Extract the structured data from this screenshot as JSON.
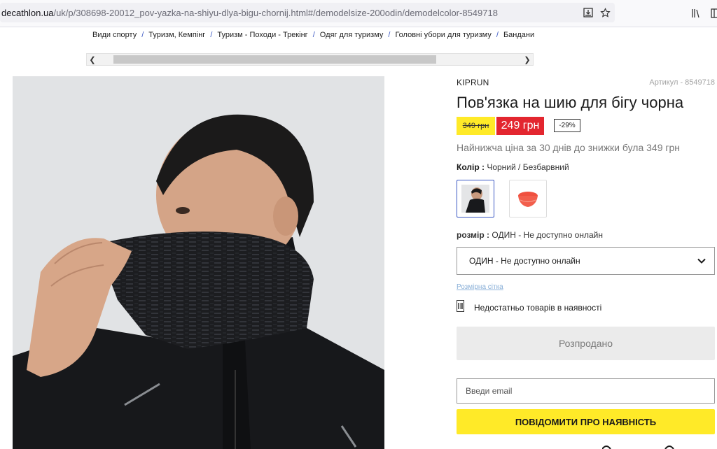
{
  "browser": {
    "url_host": "decathlon.ua",
    "url_path": "/uk/p/308698-20012_pov-yazka-na-shiyu-dlya-bigu-chornij.html#/demodelsize-200odin/demodelcolor-8549718",
    "icons": [
      "save-page-icon",
      "bookmark-star-icon",
      "library-icon",
      "sidebar-icon"
    ]
  },
  "breadcrumb": [
    "Види спорту",
    "Туризм, Кемпінг",
    "Туризм - Походи - Трекінг",
    "Одяг для туризму",
    "Головні убори для туризму",
    "Бандани"
  ],
  "breadcrumb_separator": "/",
  "product": {
    "brand": "KIPRUN",
    "article": "Артикул - 8549718",
    "title": "Пов'язка на шию для бігу чорна",
    "old_price": "349 грн",
    "new_price": "249 грн",
    "discount": "-29%",
    "lowest_price_note": "Найнижча ціна за 30 днів до знижки була 349 грн",
    "color_label": "Колір :",
    "color_value": "Чорний / Безбарвний",
    "size_label": "розмір :",
    "size_value": "ОДИН - Не доступно онлайн",
    "size_select_value": "ОДИН - Не доступно онлайн",
    "size_guide": "Розмірна сітка",
    "stock_text": "Недостатньо товарів в наявності",
    "soldout_button": "Розпродано",
    "email_placeholder": "Введи email",
    "notify_button": "ПОВІДОМИТИ ПРО НАЯВНІСТЬ"
  },
  "colors": {
    "accent_yellow": "#ffea28",
    "sale_red": "#e3262f",
    "link_blue": "#3c59c4",
    "swatch_coral": "#f25e4c"
  }
}
